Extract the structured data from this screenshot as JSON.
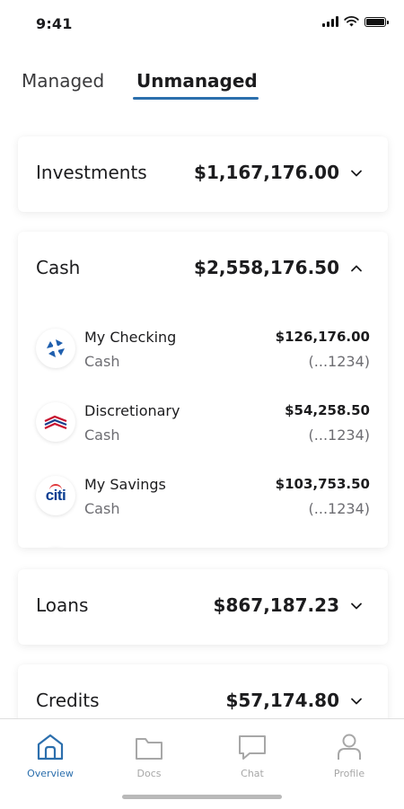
{
  "status_bar": {
    "time": "9:41"
  },
  "tabs": [
    {
      "label": "Managed",
      "active": false
    },
    {
      "label": "Unmanaged",
      "active": true
    }
  ],
  "groups": {
    "investments": {
      "title": "Investments",
      "amount": "$1,167,176.00",
      "chevron": "chevron-down-icon"
    },
    "cash": {
      "title": "Cash",
      "amount": "$2,558,176.50",
      "chevron": "chevron-up-icon",
      "accounts": [
        {
          "name": "My Checking",
          "type": "Cash",
          "balance": "$126,176.00",
          "number": "(...1234)",
          "logo": "chase-logo"
        },
        {
          "name": "Discretionary",
          "type": "Cash",
          "balance": "$54,258.50",
          "number": "(...1234)",
          "logo": "bank-of-america-logo"
        },
        {
          "name": "My Savings",
          "type": "Cash",
          "balance": "$103,753.50",
          "number": "(...1234)",
          "logo": "citi-logo",
          "logo_text": "citi"
        }
      ]
    },
    "loans": {
      "title": "Loans",
      "amount": "$867,187.23",
      "chevron": "chevron-down-icon"
    },
    "credits": {
      "title": "Credits",
      "amount": "$57,174.80",
      "chevron": "chevron-down-icon"
    }
  },
  "bottom_nav": [
    {
      "label": "Overview",
      "icon": "home-icon",
      "active": true
    },
    {
      "label": "Docs",
      "icon": "folder-icon",
      "active": false
    },
    {
      "label": "Chat",
      "icon": "chat-bubble-icon",
      "active": false
    },
    {
      "label": "Profile",
      "icon": "profile-icon",
      "active": false
    }
  ],
  "colors": {
    "accent": "#2c6fad",
    "text_primary": "#1c1c1e",
    "text_secondary": "#6d6d72",
    "nav_inactive": "#a7a7a7"
  }
}
